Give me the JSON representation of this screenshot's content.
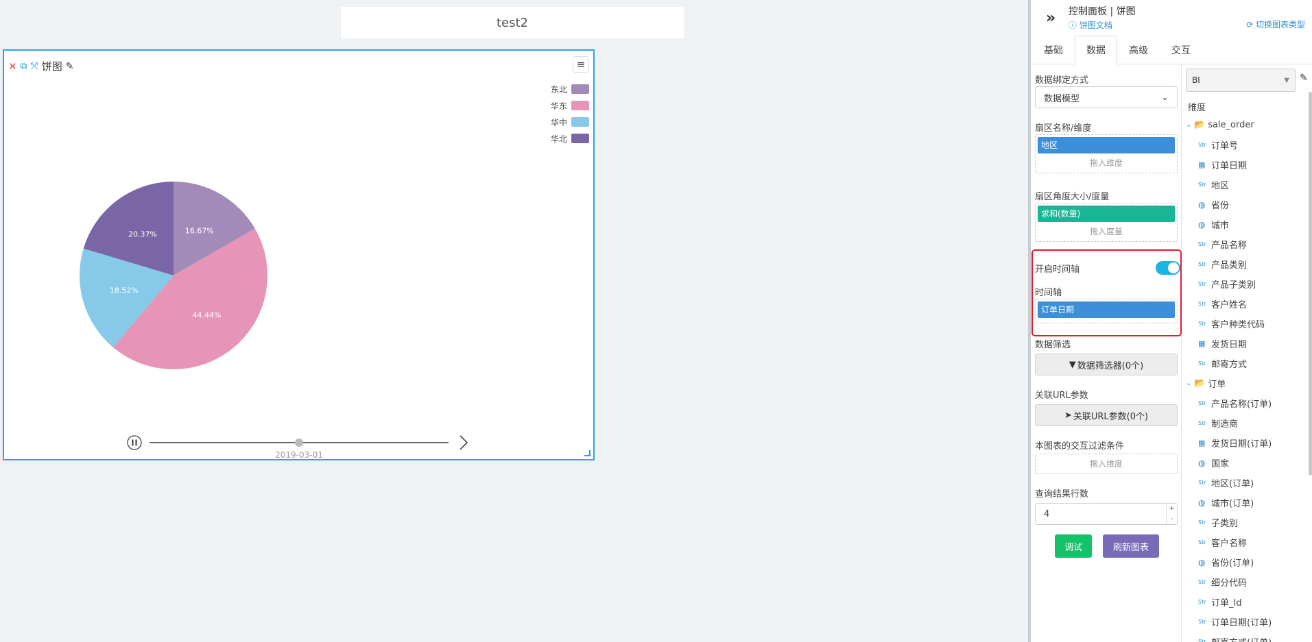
{
  "page_title": "test2",
  "chart_card": {
    "title": "饼图",
    "tool_icons": [
      "close-icon",
      "copy-icon",
      "fullscreen-icon",
      "pencil-icon"
    ],
    "menu_icon": "≡"
  },
  "chart_data": {
    "type": "pie",
    "categories": [
      "东北",
      "华东",
      "华中",
      "华北"
    ],
    "values": [
      16.67,
      44.44,
      18.52,
      20.37
    ],
    "labels": [
      "16.67%",
      "44.44%",
      "18.52%",
      "20.37%"
    ],
    "colors": [
      "#a28bb8",
      "#e694b8",
      "#86c9e8",
      "#7a66a6"
    ],
    "legend_position": "top-right"
  },
  "timeline": {
    "current_label": "2019-03-01",
    "state": "playing",
    "progress": 0.5
  },
  "panel": {
    "header_title": "控制面板 | 饼图",
    "doc_link": "饼图文档",
    "switch_type": "切换图表类型",
    "tabs": [
      "基础",
      "数据",
      "高级",
      "交互"
    ],
    "active_tab": "数据",
    "binding_label": "数据绑定方式",
    "binding_value": "数据模型",
    "sector_name_label": "扇区名称/维度",
    "sector_name_pill": "地区",
    "drop_dimension": "拖入维度",
    "sector_angle_label": "扇区角度大小/度量",
    "sector_angle_pill": "求和(数量)",
    "drop_measure": "拖入度量",
    "timeline_toggle_label": "开启时间轴",
    "timeline_toggle_on": true,
    "timeline_label": "时间轴",
    "timeline_pill": "订单日期",
    "filter_label": "数据筛选",
    "filter_button": "数据筛选器(0个)",
    "url_label": "关联URL参数",
    "url_button": "关联URL参数(0个)",
    "interaction_label": "本图表的交互过滤条件",
    "interaction_drop": "拖入维度",
    "rows_label": "查询结果行数",
    "rows_value": "4",
    "debug_button": "调试",
    "refresh_button": "刷新图表",
    "datasource": "BI",
    "dimension_label": "维度"
  },
  "tree": [
    {
      "kind": "group",
      "label": "sale_order"
    },
    {
      "kind": "field",
      "type": "Str",
      "label": "订单号"
    },
    {
      "kind": "field",
      "type": "date",
      "label": "订单日期"
    },
    {
      "kind": "field",
      "type": "Str",
      "label": "地区"
    },
    {
      "kind": "field",
      "type": "geo",
      "label": "省份"
    },
    {
      "kind": "field",
      "type": "geo",
      "label": "城市"
    },
    {
      "kind": "field",
      "type": "Str",
      "label": "产品名称"
    },
    {
      "kind": "field",
      "type": "Str",
      "label": "产品类别"
    },
    {
      "kind": "field",
      "type": "Str",
      "label": "产品子类别"
    },
    {
      "kind": "field",
      "type": "Str",
      "label": "客户姓名"
    },
    {
      "kind": "field",
      "type": "Str",
      "label": "客户种类代码"
    },
    {
      "kind": "field",
      "type": "date",
      "label": "发货日期"
    },
    {
      "kind": "field",
      "type": "Str",
      "label": "邮寄方式"
    },
    {
      "kind": "group",
      "label": "订单"
    },
    {
      "kind": "field",
      "type": "Str",
      "label": "产品名称(订单)"
    },
    {
      "kind": "field",
      "type": "Str",
      "label": "制造商"
    },
    {
      "kind": "field",
      "type": "date",
      "label": "发货日期(订单)"
    },
    {
      "kind": "field",
      "type": "geo",
      "label": "国家"
    },
    {
      "kind": "field",
      "type": "Str",
      "label": "地区(订单)"
    },
    {
      "kind": "field",
      "type": "geo",
      "label": "城市(订单)"
    },
    {
      "kind": "field",
      "type": "Str",
      "label": "子类别"
    },
    {
      "kind": "field",
      "type": "Str",
      "label": "客户名称"
    },
    {
      "kind": "field",
      "type": "geo",
      "label": "省份(订单)"
    },
    {
      "kind": "field",
      "type": "Str",
      "label": "细分代码"
    },
    {
      "kind": "field",
      "type": "Str",
      "label": "订单_Id"
    },
    {
      "kind": "field",
      "type": "Str",
      "label": "订单日期(订单)"
    },
    {
      "kind": "field",
      "type": "Str",
      "label": "邮寄方式(订单)"
    }
  ]
}
